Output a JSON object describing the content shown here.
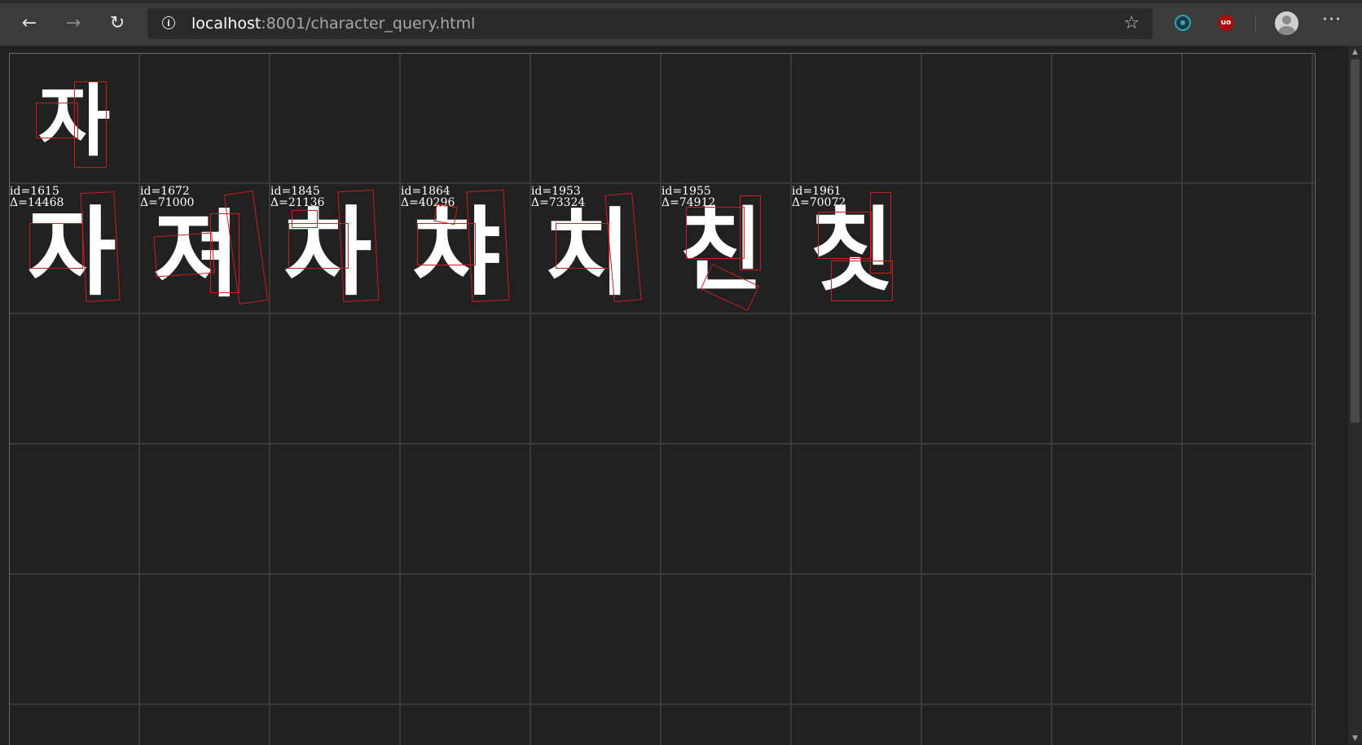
{
  "browser": {
    "url_host": "localhost",
    "url_path": ":8001/character_query.html",
    "info_icon": "i",
    "star_icon": "☆",
    "menu_icon": "···",
    "back_icon": "←",
    "forward_icon": "→",
    "refresh_icon": "↻",
    "ublock_label": "uo"
  },
  "query": {
    "glyph": "자"
  },
  "results": [
    {
      "label": "id=1615\nΔ=14468",
      "glyph": "자"
    },
    {
      "label": "id=1672\nΔ=71000",
      "glyph": "져"
    },
    {
      "label": "id=1845\nΔ=21136",
      "glyph": "차"
    },
    {
      "label": "id=1864\nΔ=40296",
      "glyph": "챠"
    },
    {
      "label": "id=1953\nΔ=73324",
      "glyph": "치"
    },
    {
      "label": "id=1955\nΔ=74912",
      "glyph": "친"
    },
    {
      "label": "id=1961\nΔ=70072",
      "glyph": "칫"
    }
  ],
  "colors": {
    "box": "#c8201f",
    "grid": "#3a3a3a",
    "background": "#212121"
  }
}
